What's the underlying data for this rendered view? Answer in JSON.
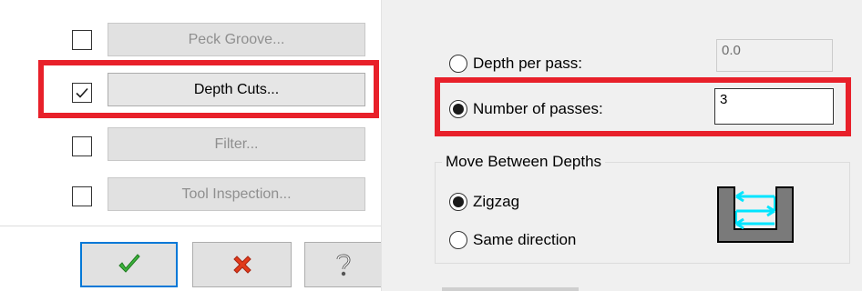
{
  "options": [
    {
      "label": "Peck Groove...",
      "checked": false,
      "enabled": false
    },
    {
      "label": "Depth Cuts...",
      "checked": true,
      "enabled": true
    },
    {
      "label": "Filter...",
      "checked": false,
      "enabled": false
    },
    {
      "label": "Tool Inspection...",
      "checked": false,
      "enabled": false
    }
  ],
  "dialog_buttons": {
    "ok_icon": "checkmark-icon",
    "cancel_icon": "red-x-icon",
    "help_icon": "question-mark-icon"
  },
  "depth": {
    "depth_per_pass_label": "Depth per pass:",
    "depth_per_pass_value": "0.0",
    "number_of_passes_label": "Number of passes:",
    "number_of_passes_value": "3",
    "selected": "number_of_passes"
  },
  "move_between_depths": {
    "title": "Move Between Depths",
    "options": [
      "Zigzag",
      "Same direction"
    ],
    "selected": "Zigzag",
    "preview_icon": "zigzag-depth-icon"
  },
  "colors": {
    "highlight": "#e8202a",
    "default_button_border": "#0078d7",
    "arrow": "#00e5ff",
    "ok_green": "#3cb43c",
    "cancel_red": "#e23b1b"
  }
}
